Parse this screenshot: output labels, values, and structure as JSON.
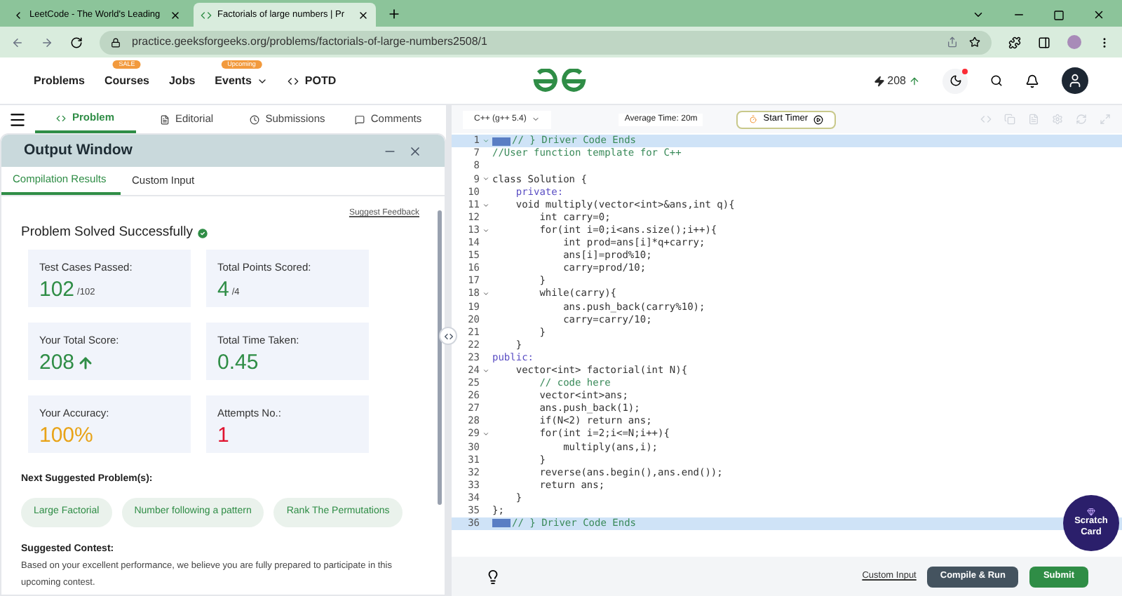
{
  "browser": {
    "tabs": [
      {
        "title": "LeetCode - The World's Leading",
        "selected": false
      },
      {
        "title": "Factorials of large numbers | Pr",
        "selected": true
      }
    ],
    "url": "practice.geeksforgeeks.org/problems/factorials-of-large-numbers2508/1"
  },
  "header": {
    "nav": [
      {
        "label": "Problems"
      },
      {
        "label": "Courses",
        "badge": "SALE"
      },
      {
        "label": "Jobs"
      },
      {
        "label": "Events",
        "badge": "Upcoming",
        "dropdown": true
      },
      {
        "label": "POTD",
        "code_icon": true
      }
    ],
    "streak": "208"
  },
  "problem_tabs": [
    {
      "label": "Problem",
      "selected": true
    },
    {
      "label": "Editorial",
      "selected": false
    },
    {
      "label": "Submissions",
      "selected": false
    },
    {
      "label": "Comments",
      "selected": false
    }
  ],
  "output": {
    "title": "Output Window",
    "tabs": [
      {
        "label": "Compilation Results",
        "selected": true
      },
      {
        "label": "Custom Input",
        "selected": false
      }
    ],
    "feedback": "Suggest Feedback",
    "status": "Problem Solved Successfully",
    "stats": [
      {
        "label": "Test Cases Passed:",
        "value": "102",
        "suffix": "/102",
        "color": "#2f8d46"
      },
      {
        "label": "Total Points Scored:",
        "value": "4",
        "suffix": "/4",
        "color": "#2f8d46"
      },
      {
        "label": "Your Total Score:",
        "value": "208",
        "arrow": true,
        "color": "#2f8d46"
      },
      {
        "label": "Total Time Taken:",
        "value": "0.45",
        "color": "#2f8d46"
      },
      {
        "label": "Your Accuracy:",
        "value": "100%",
        "color": "#e8a317"
      },
      {
        "label": "Attempts No.:",
        "value": "1",
        "color": "#e0132f"
      }
    ],
    "suggested_heading": "Next Suggested Problem(s):",
    "suggested": [
      "Large Factorial",
      "Number following a pattern",
      "Rank The Permutations"
    ],
    "contest_heading": "Suggested Contest:",
    "contest_text": "Based on your excellent performance, we believe you are fully prepared to participate in this upcoming contest."
  },
  "editor": {
    "language": "C++ (g++ 5.4)",
    "avg_time": "Average Time: 20m",
    "timer": "Start Timer",
    "lines": [
      {
        "num": "1",
        "text": "// } Driver Code Ends",
        "kind": "comment",
        "fold": true,
        "marker": true,
        "selected": true
      },
      {
        "num": "7",
        "text": "//User function template for C++",
        "kind": "comment"
      },
      {
        "num": "8",
        "kind": "code"
      },
      {
        "num": "9",
        "text": "class Solution {",
        "kind": "code",
        "fold": true
      },
      {
        "num": "10",
        "text": "    private:",
        "kind": "keyword"
      },
      {
        "num": "11",
        "text": "    void multiply(vector<int>&ans,int q){",
        "kind": "code",
        "fold": true
      },
      {
        "num": "12",
        "text": "        int carry=0;",
        "kind": "code"
      },
      {
        "num": "13",
        "text": "        for(int i=0;i<ans.size();i++){",
        "kind": "code",
        "fold": true
      },
      {
        "num": "14",
        "text": "            int prod=ans[i]*q+carry;",
        "kind": "code"
      },
      {
        "num": "15",
        "text": "            ans[i]=prod%10;",
        "kind": "code"
      },
      {
        "num": "16",
        "text": "            carry=prod/10;",
        "kind": "code"
      },
      {
        "num": "17",
        "text": "        }",
        "kind": "code"
      },
      {
        "num": "18",
        "text": "        while(carry){",
        "kind": "code",
        "fold": true
      },
      {
        "num": "19",
        "text": "            ans.push_back(carry%10);",
        "kind": "code"
      },
      {
        "num": "20",
        "text": "            carry=carry/10;",
        "kind": "code"
      },
      {
        "num": "21",
        "text": "        }",
        "kind": "code"
      },
      {
        "num": "22",
        "text": "    }",
        "kind": "code"
      },
      {
        "num": "23",
        "text": "public:",
        "kind": "keyword"
      },
      {
        "num": "24",
        "text": "    vector<int> factorial(int N){",
        "kind": "code",
        "fold": true
      },
      {
        "num": "25",
        "text": "        // code here",
        "kind": "comment"
      },
      {
        "num": "26",
        "text": "        vector<int>ans;",
        "kind": "code"
      },
      {
        "num": "27",
        "text": "        ans.push_back(1);",
        "kind": "code"
      },
      {
        "num": "28",
        "text": "        if(N<2) return ans;",
        "kind": "code"
      },
      {
        "num": "29",
        "text": "        for(int i=2;i<=N;i++){",
        "kind": "code",
        "fold": true
      },
      {
        "num": "30",
        "text": "            multiply(ans,i);",
        "kind": "code"
      },
      {
        "num": "31",
        "text": "        }",
        "kind": "code"
      },
      {
        "num": "32",
        "text": "        reverse(ans.begin(),ans.end());",
        "kind": "code"
      },
      {
        "num": "33",
        "text": "        return ans;",
        "kind": "code"
      },
      {
        "num": "34",
        "text": "    }",
        "kind": "code"
      },
      {
        "num": "35",
        "text": "};",
        "kind": "code"
      },
      {
        "num": "36",
        "text": "// } Driver Code Ends",
        "kind": "comment",
        "marker": true,
        "selected": true
      }
    ]
  },
  "footer": {
    "custom_input": "Custom Input",
    "compile": "Compile & Run",
    "submit": "Submit"
  },
  "scratch": "Scratch Card"
}
